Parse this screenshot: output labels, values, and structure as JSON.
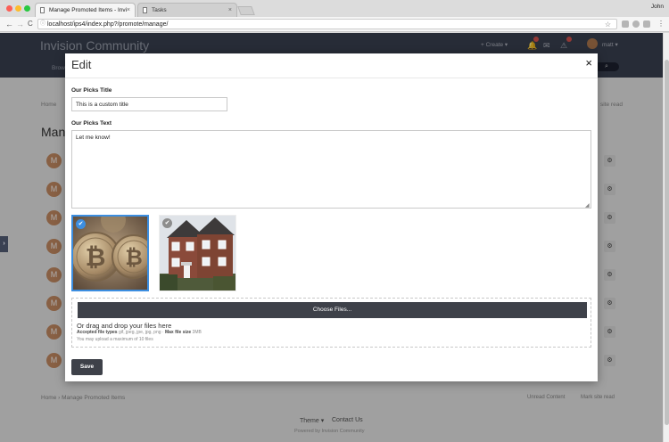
{
  "browser": {
    "tabs": [
      {
        "label": "Manage Promoted Items - Invi",
        "close": "×"
      },
      {
        "label": "Tasks",
        "close": "×"
      }
    ],
    "user": "John",
    "nav": {
      "back": "←",
      "forward": "→",
      "reload": "C"
    },
    "url": "localhost/ips4/index.php?/promote/manage/",
    "star": "☆"
  },
  "site": {
    "brand": "Invision Community",
    "nav_item": "Brow",
    "create": "+ Create ▾",
    "user_menu": "matt ▾",
    "search_icon": "search-icon",
    "breadcrumb_top": "Home",
    "title_fragment": "Man",
    "breadcrumb_bottom": "Home  ›  Manage Promoted Items",
    "unread": "Unread Content",
    "mark_read_top": "site read",
    "mark_read_bottom": "Mark site read",
    "footer_theme": "Theme ▾",
    "footer_contact": "Contact Us",
    "footer_powered": "Powered by Invision Community",
    "row_avatar_letter": "M"
  },
  "modal": {
    "title": "Edit",
    "close": "×",
    "picks_title_label": "Our Picks Title",
    "picks_title_value": "This is a custom title",
    "picks_text_label": "Our Picks Text",
    "picks_text_value": "Let me know!",
    "images": [
      {
        "name": "bitcoin-coins-image",
        "selected": true
      },
      {
        "name": "brick-house-image",
        "selected": false
      }
    ],
    "check_glyph": "✔",
    "choose_files": "Choose Files...",
    "drag_drop": "Or drag and drop your files here",
    "accepted_label": "Accepted file types",
    "accepted_types": "gif, jpeg, jpe, jpg, png",
    "max_size_label": "Max file size",
    "max_size": "3MB",
    "max_upload": "You may upload a maximum of 10 files",
    "save": "Save"
  },
  "colors": {
    "accent": "#3c8ee0",
    "header": "#3a4152",
    "button": "#3e4149"
  }
}
